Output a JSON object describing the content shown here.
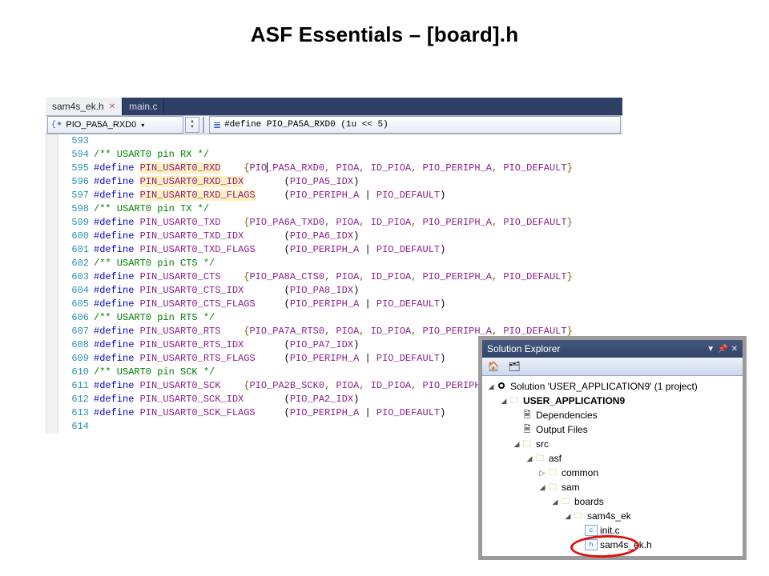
{
  "slide_title": "ASF Essentials – [board].h",
  "tabs": [
    {
      "label": "sam4s_ek.h",
      "active": true
    },
    {
      "label": "main.c",
      "active": false
    }
  ],
  "navbar": {
    "left_combo": "PIO_PA5A_RXD0",
    "def_line": "#define PIO_PA5A_RXD0 (1u << 5)"
  },
  "code": {
    "first_line": 593,
    "lines": [
      [],
      [
        {
          "t": "cmt",
          "s": "/** USART0 pin RX */"
        }
      ],
      [
        {
          "t": "kw",
          "s": "#define "
        },
        {
          "t": "mac",
          "s": "PIN_USART0_RXD",
          "hl": true
        },
        {
          "t": "txt",
          "s": "    "
        },
        {
          "t": "op",
          "s": "{"
        },
        {
          "t": "mac",
          "s": "PIO"
        },
        {
          "t": "caret",
          "s": ""
        },
        {
          "t": "mac",
          "s": "_PA5A_RXD0"
        },
        {
          "t": "op",
          "s": ", "
        },
        {
          "t": "mac",
          "s": "PIOA"
        },
        {
          "t": "op",
          "s": ", "
        },
        {
          "t": "mac",
          "s": "ID_PIOA"
        },
        {
          "t": "op",
          "s": ", "
        },
        {
          "t": "mac",
          "s": "PIO_PERIPH_A"
        },
        {
          "t": "op",
          "s": ", "
        },
        {
          "t": "mac",
          "s": "PIO_DEFAULT"
        },
        {
          "t": "op",
          "s": "}"
        }
      ],
      [
        {
          "t": "kw",
          "s": "#define "
        },
        {
          "t": "mac",
          "s": "PIN_USART0_RXD_IDX",
          "hl": true
        },
        {
          "t": "txt",
          "s": "       ("
        },
        {
          "t": "mac",
          "s": "PIO_PA5_IDX"
        },
        {
          "t": "txt",
          "s": ")"
        }
      ],
      [
        {
          "t": "kw",
          "s": "#define "
        },
        {
          "t": "mac",
          "s": "PIN_USART0_RXD_FLAGS",
          "hl": true
        },
        {
          "t": "txt",
          "s": "     ("
        },
        {
          "t": "mac",
          "s": "PIO_PERIPH_A"
        },
        {
          "t": "txt",
          "s": " | "
        },
        {
          "t": "mac",
          "s": "PIO_DEFAULT"
        },
        {
          "t": "txt",
          "s": ")"
        }
      ],
      [
        {
          "t": "cmt",
          "s": "/** USART0 pin TX */"
        }
      ],
      [
        {
          "t": "kw",
          "s": "#define "
        },
        {
          "t": "mac",
          "s": "PIN_USART0_TXD"
        },
        {
          "t": "txt",
          "s": "    "
        },
        {
          "t": "op",
          "s": "{"
        },
        {
          "t": "mac",
          "s": "PIO_PA6A_TXD0"
        },
        {
          "t": "op",
          "s": ", "
        },
        {
          "t": "mac",
          "s": "PIOA"
        },
        {
          "t": "op",
          "s": ", "
        },
        {
          "t": "mac",
          "s": "ID_PIOA"
        },
        {
          "t": "op",
          "s": ", "
        },
        {
          "t": "mac",
          "s": "PIO_PERIPH_A"
        },
        {
          "t": "op",
          "s": ", "
        },
        {
          "t": "mac",
          "s": "PIO_DEFAULT"
        },
        {
          "t": "op",
          "s": "}"
        }
      ],
      [
        {
          "t": "kw",
          "s": "#define "
        },
        {
          "t": "mac",
          "s": "PIN_USART0_TXD_IDX"
        },
        {
          "t": "txt",
          "s": "       ("
        },
        {
          "t": "mac",
          "s": "PIO_PA6_IDX"
        },
        {
          "t": "txt",
          "s": ")"
        }
      ],
      [
        {
          "t": "kw",
          "s": "#define "
        },
        {
          "t": "mac",
          "s": "PIN_USART0_TXD_FLAGS"
        },
        {
          "t": "txt",
          "s": "     ("
        },
        {
          "t": "mac",
          "s": "PIO_PERIPH_A"
        },
        {
          "t": "txt",
          "s": " | "
        },
        {
          "t": "mac",
          "s": "PIO_DEFAULT"
        },
        {
          "t": "txt",
          "s": ")"
        }
      ],
      [
        {
          "t": "cmt",
          "s": "/** USART0 pin CTS */"
        }
      ],
      [
        {
          "t": "kw",
          "s": "#define "
        },
        {
          "t": "mac",
          "s": "PIN_USART0_CTS"
        },
        {
          "t": "txt",
          "s": "    "
        },
        {
          "t": "op",
          "s": "{"
        },
        {
          "t": "mac",
          "s": "PIO_PA8A_CTS0"
        },
        {
          "t": "op",
          "s": ", "
        },
        {
          "t": "mac",
          "s": "PIOA"
        },
        {
          "t": "op",
          "s": ", "
        },
        {
          "t": "mac",
          "s": "ID_PIOA"
        },
        {
          "t": "op",
          "s": ", "
        },
        {
          "t": "mac",
          "s": "PIO_PERIPH_A"
        },
        {
          "t": "op",
          "s": ", "
        },
        {
          "t": "mac",
          "s": "PIO_DEFAULT"
        },
        {
          "t": "op",
          "s": "}"
        }
      ],
      [
        {
          "t": "kw",
          "s": "#define "
        },
        {
          "t": "mac",
          "s": "PIN_USART0_CTS_IDX"
        },
        {
          "t": "txt",
          "s": "       ("
        },
        {
          "t": "mac",
          "s": "PIO_PA8_IDX"
        },
        {
          "t": "txt",
          "s": ")"
        }
      ],
      [
        {
          "t": "kw",
          "s": "#define "
        },
        {
          "t": "mac",
          "s": "PIN_USART0_CTS_FLAGS"
        },
        {
          "t": "txt",
          "s": "     ("
        },
        {
          "t": "mac",
          "s": "PIO_PERIPH_A"
        },
        {
          "t": "txt",
          "s": " | "
        },
        {
          "t": "mac",
          "s": "PIO_DEFAULT"
        },
        {
          "t": "txt",
          "s": ")"
        }
      ],
      [
        {
          "t": "cmt",
          "s": "/** USART0 pin RTS */"
        }
      ],
      [
        {
          "t": "kw",
          "s": "#define "
        },
        {
          "t": "mac",
          "s": "PIN_USART0_RTS"
        },
        {
          "t": "txt",
          "s": "    "
        },
        {
          "t": "op",
          "s": "{"
        },
        {
          "t": "mac",
          "s": "PIO_PA7A_RTS0"
        },
        {
          "t": "op",
          "s": ", "
        },
        {
          "t": "mac",
          "s": "PIOA"
        },
        {
          "t": "op",
          "s": ", "
        },
        {
          "t": "mac",
          "s": "ID_PIOA"
        },
        {
          "t": "op",
          "s": ", "
        },
        {
          "t": "mac",
          "s": "PIO_PERIPH_A"
        },
        {
          "t": "op",
          "s": ", "
        },
        {
          "t": "mac",
          "s": "PIO_DEFAULT"
        },
        {
          "t": "op",
          "s": "}"
        }
      ],
      [
        {
          "t": "kw",
          "s": "#define "
        },
        {
          "t": "mac",
          "s": "PIN_USART0_RTS_IDX"
        },
        {
          "t": "txt",
          "s": "       ("
        },
        {
          "t": "mac",
          "s": "PIO_PA7_IDX"
        },
        {
          "t": "txt",
          "s": ")"
        }
      ],
      [
        {
          "t": "kw",
          "s": "#define "
        },
        {
          "t": "mac",
          "s": "PIN_USART0_RTS_FLAGS"
        },
        {
          "t": "txt",
          "s": "     ("
        },
        {
          "t": "mac",
          "s": "PIO_PERIPH_A"
        },
        {
          "t": "txt",
          "s": " | "
        },
        {
          "t": "mac",
          "s": "PIO_DEFAULT"
        },
        {
          "t": "txt",
          "s": ")"
        }
      ],
      [
        {
          "t": "cmt",
          "s": "/** USART0 pin SCK */"
        }
      ],
      [
        {
          "t": "kw",
          "s": "#define "
        },
        {
          "t": "mac",
          "s": "PIN_USART0_SCK"
        },
        {
          "t": "txt",
          "s": "    "
        },
        {
          "t": "op",
          "s": "{"
        },
        {
          "t": "mac",
          "s": "PIO_PA2B_SCK0"
        },
        {
          "t": "op",
          "s": ", "
        },
        {
          "t": "mac",
          "s": "PIOA"
        },
        {
          "t": "op",
          "s": ", "
        },
        {
          "t": "mac",
          "s": "ID_PIOA"
        },
        {
          "t": "op",
          "s": ", "
        },
        {
          "t": "mac",
          "s": "PIO_PERIPH"
        }
      ],
      [
        {
          "t": "kw",
          "s": "#define "
        },
        {
          "t": "mac",
          "s": "PIN_USART0_SCK_IDX"
        },
        {
          "t": "txt",
          "s": "       ("
        },
        {
          "t": "mac",
          "s": "PIO_PA2_IDX"
        },
        {
          "t": "txt",
          "s": ")"
        }
      ],
      [
        {
          "t": "kw",
          "s": "#define "
        },
        {
          "t": "mac",
          "s": "PIN_USART0_SCK_FLAGS"
        },
        {
          "t": "txt",
          "s": "     ("
        },
        {
          "t": "mac",
          "s": "PIO_PERIPH_A"
        },
        {
          "t": "txt",
          "s": " | "
        },
        {
          "t": "mac",
          "s": "PIO_DEFAULT"
        },
        {
          "t": "txt",
          "s": ")"
        }
      ],
      []
    ]
  },
  "solution_explorer": {
    "title": "Solution Explorer",
    "root": "Solution 'USER_APPLICATION9' (1 project)",
    "nodes": [
      {
        "depth": 0,
        "twist": "◢",
        "icon": "sol",
        "label": "Solution 'USER_APPLICATION9' (1 project)"
      },
      {
        "depth": 1,
        "twist": "◢",
        "icon": "proj",
        "label": "USER_APPLICATION9",
        "bold": true
      },
      {
        "depth": 2,
        "twist": "",
        "icon": "dep",
        "label": "Dependencies"
      },
      {
        "depth": 2,
        "twist": "",
        "icon": "out",
        "label": "Output Files"
      },
      {
        "depth": 2,
        "twist": "◢",
        "icon": "folder",
        "label": "src"
      },
      {
        "depth": 3,
        "twist": "◢",
        "icon": "folder",
        "label": "asf"
      },
      {
        "depth": 4,
        "twist": "▷",
        "icon": "folder",
        "label": "common"
      },
      {
        "depth": 4,
        "twist": "◢",
        "icon": "folder",
        "label": "sam"
      },
      {
        "depth": 5,
        "twist": "◢",
        "icon": "folder",
        "label": "boards"
      },
      {
        "depth": 6,
        "twist": "◢",
        "icon": "folder",
        "label": "sam4s_ek"
      },
      {
        "depth": 7,
        "twist": "",
        "icon": "cfile",
        "label": "init.c"
      },
      {
        "depth": 7,
        "twist": "",
        "icon": "hfile",
        "label": "sam4s_ek.h",
        "circled": true
      }
    ]
  }
}
